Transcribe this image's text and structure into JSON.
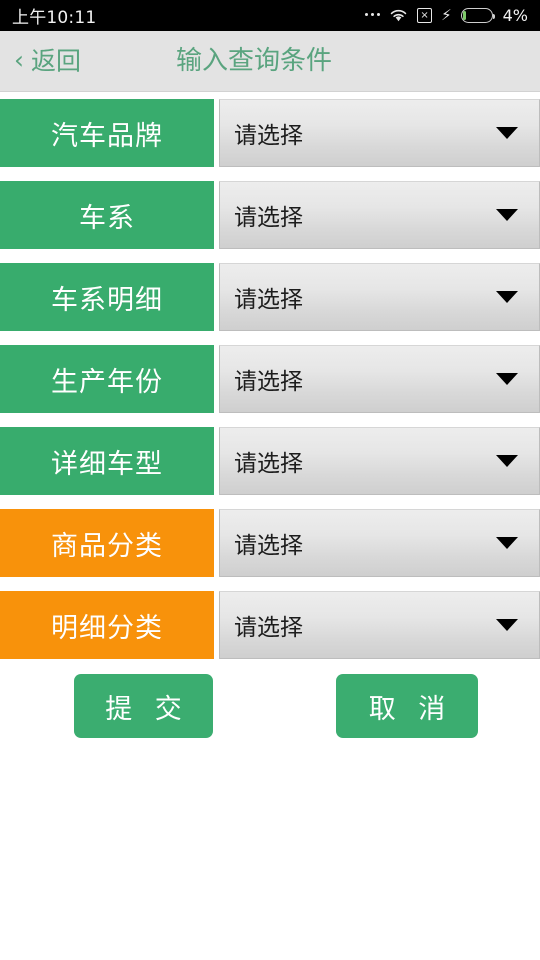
{
  "status_bar": {
    "time": "上午10:11",
    "battery_percent": "4%",
    "icons": [
      "more-dots-icon",
      "wifi-icon",
      "no-sim-icon",
      "charging-bolt-icon",
      "battery-icon"
    ]
  },
  "header": {
    "back_label": "返回",
    "back_chevron": "‹",
    "title": "输入查询条件",
    "accent_color": "#5aa47f",
    "background_color": "#e3e3e3"
  },
  "colors": {
    "green": "#38ac6d",
    "orange": "#f8920b",
    "button_green": "#3bad70",
    "select_text": "#1d1d1d"
  },
  "form": {
    "placeholder": "请选择",
    "rows": [
      {
        "label": "汽车品牌",
        "color": "green",
        "value": "请选择"
      },
      {
        "label": "车系",
        "color": "green",
        "value": "请选择"
      },
      {
        "label": "车系明细",
        "color": "green",
        "value": "请选择"
      },
      {
        "label": "生产年份",
        "color": "green",
        "value": "请选择"
      },
      {
        "label": "详细车型",
        "color": "green",
        "value": "请选择"
      },
      {
        "label": "商品分类",
        "color": "orange",
        "value": "请选择"
      },
      {
        "label": "明细分类",
        "color": "orange",
        "value": "请选择"
      }
    ]
  },
  "actions": {
    "submit_label": "提 交",
    "cancel_label": "取 消"
  }
}
